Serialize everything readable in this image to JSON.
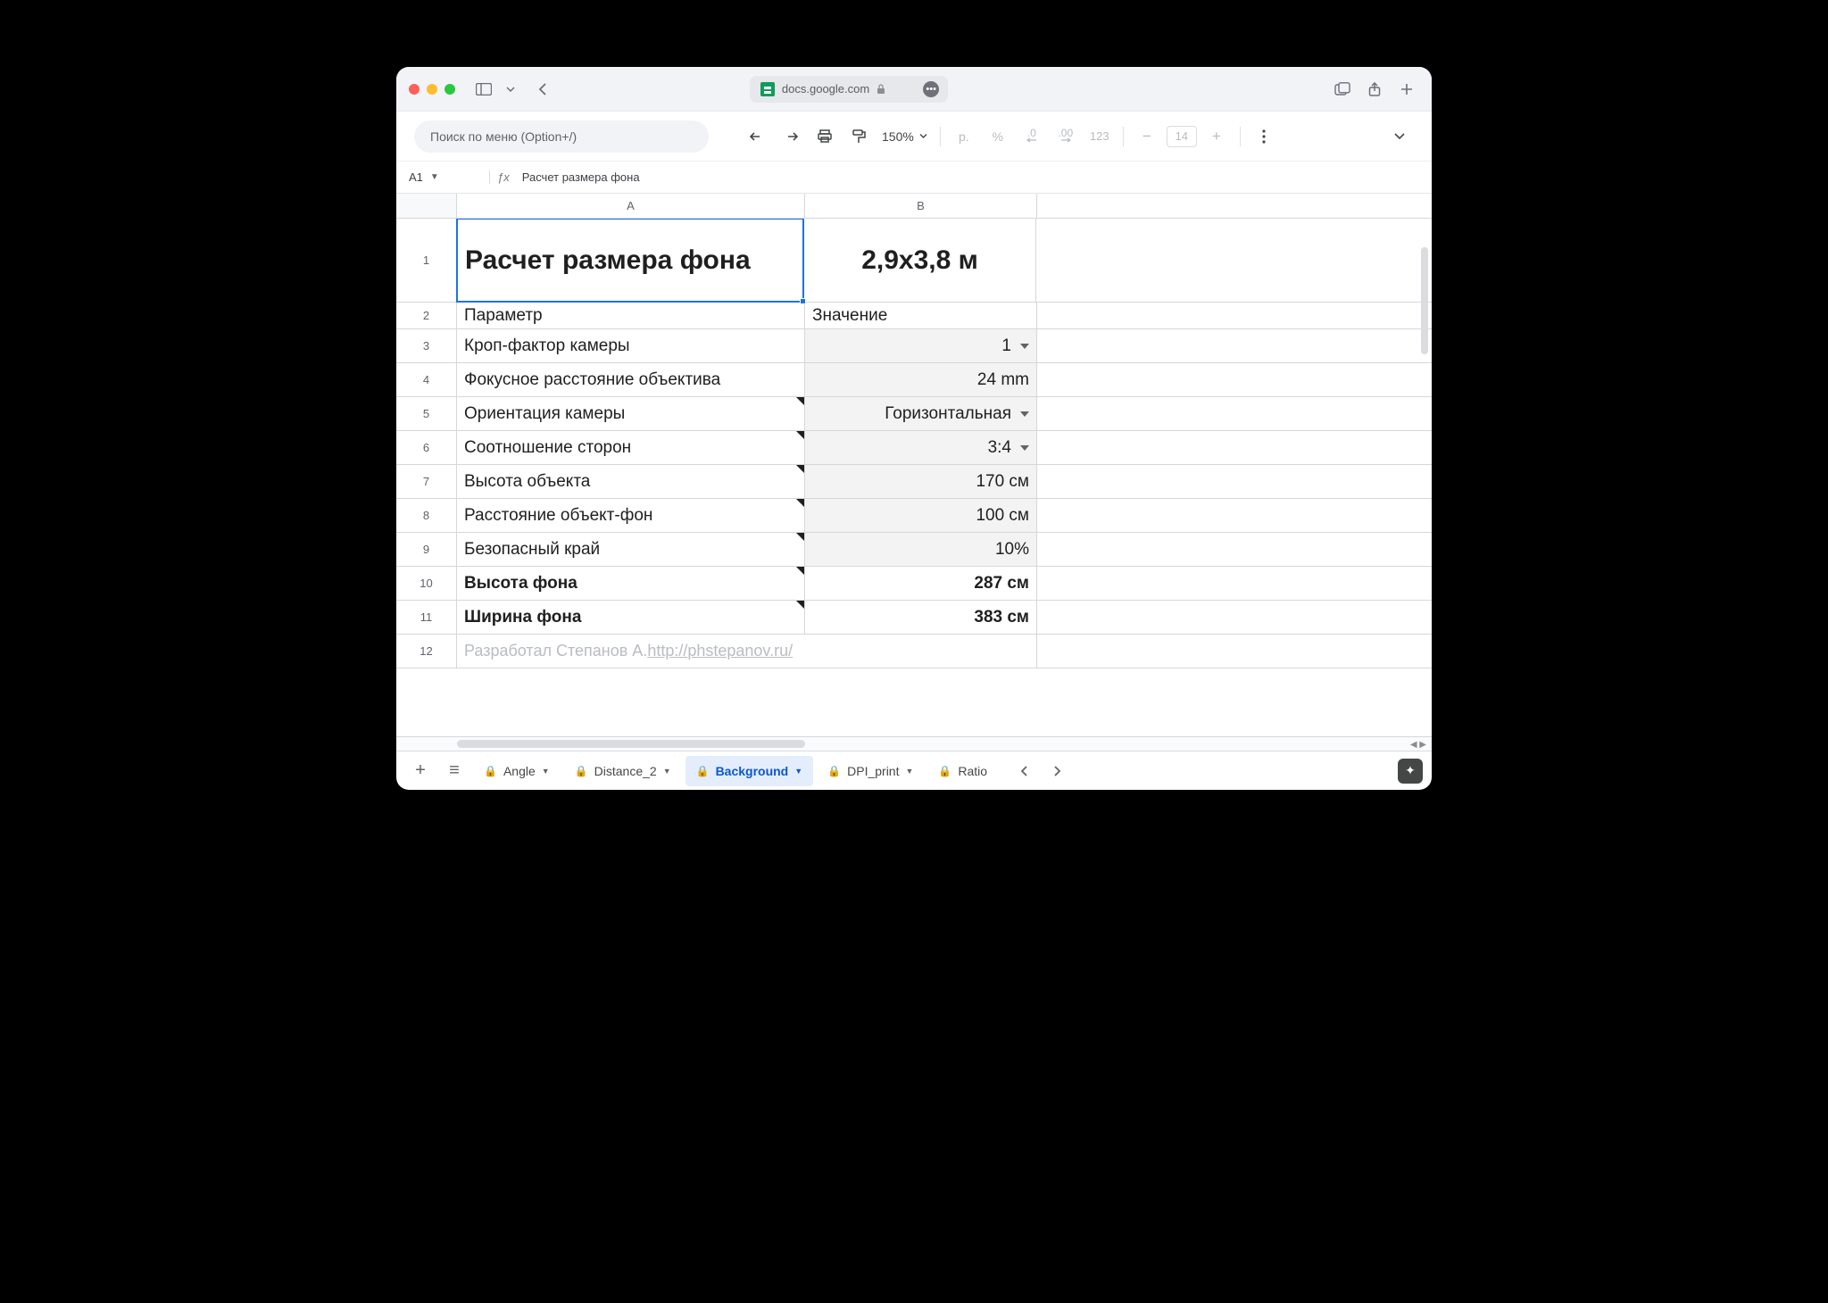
{
  "browser": {
    "domain": "docs.google.com"
  },
  "toolbar": {
    "search_placeholder": "Поиск по меню (Option+/)",
    "zoom": "150%",
    "currency_symbol": "р.",
    "font_size": "14"
  },
  "namebox": {
    "ref": "A1",
    "formula": "Расчет размера фона"
  },
  "columns": {
    "A": "A",
    "B": "B"
  },
  "sheet": {
    "rows": [
      {
        "n": "1",
        "a": "Расчет размера фона",
        "b": "2,9x3,8 м"
      },
      {
        "n": "2",
        "a": "Параметр",
        "b": "Значение"
      },
      {
        "n": "3",
        "a": "Кроп-фактор камеры",
        "b": "1"
      },
      {
        "n": "4",
        "a": "Фокусное расстояние объектива",
        "b": "24 mm"
      },
      {
        "n": "5",
        "a": "Ориентация камеры",
        "b": "Горизонтальная"
      },
      {
        "n": "6",
        "a": "Соотношение сторон",
        "b": "3:4"
      },
      {
        "n": "7",
        "a": "Высота объекта",
        "b": "170 см"
      },
      {
        "n": "8",
        "a": "Расстояние объект-фон",
        "b": "100 см"
      },
      {
        "n": "9",
        "a": "Безопасный край",
        "b": "10%"
      },
      {
        "n": "10",
        "a": "Высота фона",
        "b": "287 см"
      },
      {
        "n": "11",
        "a": "Ширина фона",
        "b": "383 см"
      },
      {
        "n": "12",
        "credit_prefix": "Разработал Степанов А. ",
        "credit_link": "http://phstepanov.ru/"
      }
    ]
  },
  "tabs": {
    "angle": "Angle",
    "distance": "Distance_2",
    "background": "Background",
    "dpi": "DPI_print",
    "ratio": "Ratio"
  },
  "misc": {
    "percent": "%",
    "decrease_dec": ".0",
    "increase_dec": ".00",
    "num_format": "123"
  }
}
